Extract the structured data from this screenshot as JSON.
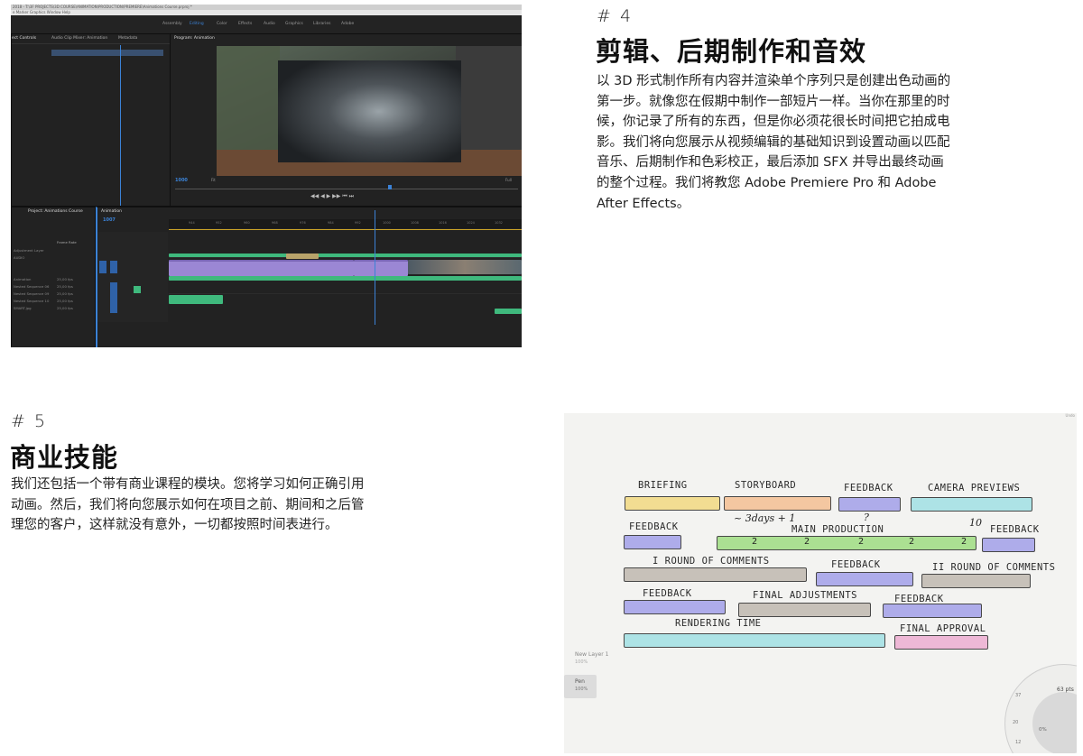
{
  "section4": {
    "number": "# 4",
    "title": "剪辑、后期制作和音效",
    "body": "以 3D 形式制作所有内容并渲染单个序列只是创建出色动画的\n第一步。就像您在假期中制作一部短片一样。当你在那里的时\n候，你记录了所有的东西，但是你必须花很长时间把它拍成电\n影。我们将向您展示从视频编辑的基础知识到设置动画以匹配\n音乐、后期制作和色彩校正，最后添加 SFX 并导出最终动画\n的整个过程。我们将教您 Adobe Premiere Pro 和 Adobe\nAfter Effects。"
  },
  "section5": {
    "number": "# 5",
    "title": "商业技能",
    "body": "我们还包括一个带有商业课程的模块。您将学习如何正确引用\n动画。然后，我们将向您展示如何在项目之前、期间和之后管\n理您的客户，这样就没有意外，一切都按照时间表进行。"
  },
  "premiere": {
    "titlebar": "2018 - T:\\3F PROJECTS\\3D COURSE\\ANIMATION\\PRODUCTION\\PREMIERE\\Animations Course.prproj *",
    "menu": "e  Marker  Graphics  Window  Help",
    "workspace_tabs": [
      "Assembly",
      "Editing",
      "Color",
      "Effects",
      "Audio",
      "Graphics",
      "Libraries",
      "Adobe"
    ],
    "active_workspace": "Editing",
    "left_panel_tabs": [
      "ect Controls",
      "Audio Clip Mixer: Animation",
      "Metadata"
    ],
    "monitor_tab": "Program: Animation",
    "monitor_timecode": "1000",
    "monitor_fit": "Fit",
    "monitor_quality": "Full",
    "project_tab": "Project: Animations Course",
    "sequence_tab": "Animation",
    "sequence_timecode": "1007",
    "project_header": "Frame Rate",
    "project_items": [
      {
        "name": "Adjustment Layer",
        "rate": ""
      },
      {
        "name": "AUDIO",
        "rate": ""
      },
      {
        "name": "Animation",
        "rate": "25,00 fps"
      },
      {
        "name": "Nested Sequence 06",
        "rate": "25,00 fps"
      },
      {
        "name": "Nested Sequence 09",
        "rate": "25,00 fps"
      },
      {
        "name": "Nested Sequence 10",
        "rate": "25,00 fps"
      },
      {
        "name": "SMART.jpg",
        "rate": "25,00 fps"
      }
    ],
    "ruler_ticks": [
      "944",
      "952",
      "960",
      "968",
      "976",
      "984",
      "992",
      "1000",
      "1008",
      "1016",
      "1024",
      "1032"
    ],
    "transport": "◀◀  ◀  ▶  ▶▶  ⏮ ⏭"
  },
  "whiteboard": {
    "bars_row1": [
      {
        "label": "BRIEFING",
        "color": "#f2dc8a"
      },
      {
        "label": "STORYBOARD",
        "color": "#f5c49b"
      },
      {
        "label": "FEEDBACK",
        "color": "#a9a6ea"
      },
      {
        "label": "CAMERA PREVIEWS",
        "color": "#a8e2e6"
      }
    ],
    "bars_row2": [
      {
        "label": "FEEDBACK",
        "color": "#a9a6ea"
      },
      {
        "label": "MAIN  PRODUCTION",
        "color": "#a5df8a"
      },
      {
        "label": "FEEDBACK",
        "color": "#a9a6ea"
      }
    ],
    "bars_row3": [
      {
        "label": "I ROUND OF COMMENTS",
        "color": "#c4bdb5"
      },
      {
        "label": "FEEDBACK",
        "color": "#a9a6ea"
      },
      {
        "label": "II ROUND OF COMMENTS",
        "color": "#c4bdb5"
      }
    ],
    "bars_row4": [
      {
        "label": "FEEDBACK",
        "color": "#a9a6ea"
      },
      {
        "label": "FINAL ADJUSTMENTS",
        "color": "#c4bdb5"
      },
      {
        "label": "FEEDBACK",
        "color": "#a9a6ea"
      }
    ],
    "bars_row5": [
      {
        "label": "RENDERING TIME",
        "color": "#a8e2e6"
      },
      {
        "label": "FINAL APPROVAL",
        "color": "#eeb3d4"
      }
    ],
    "note_days": "~ 3days + 1",
    "note_question": "?",
    "note_ten": "10",
    "production_marks": [
      "2",
      "2",
      "2",
      "2",
      "2"
    ],
    "layer_name": "New Layer 1",
    "layer_opacity": "100%",
    "tool_name": "Pen",
    "tool_opacity": "100%",
    "brush_size": "63 pts",
    "brush_opacity": "0%",
    "dial_ticks": [
      "37",
      "20",
      "12"
    ],
    "corner_label": "Undo"
  }
}
